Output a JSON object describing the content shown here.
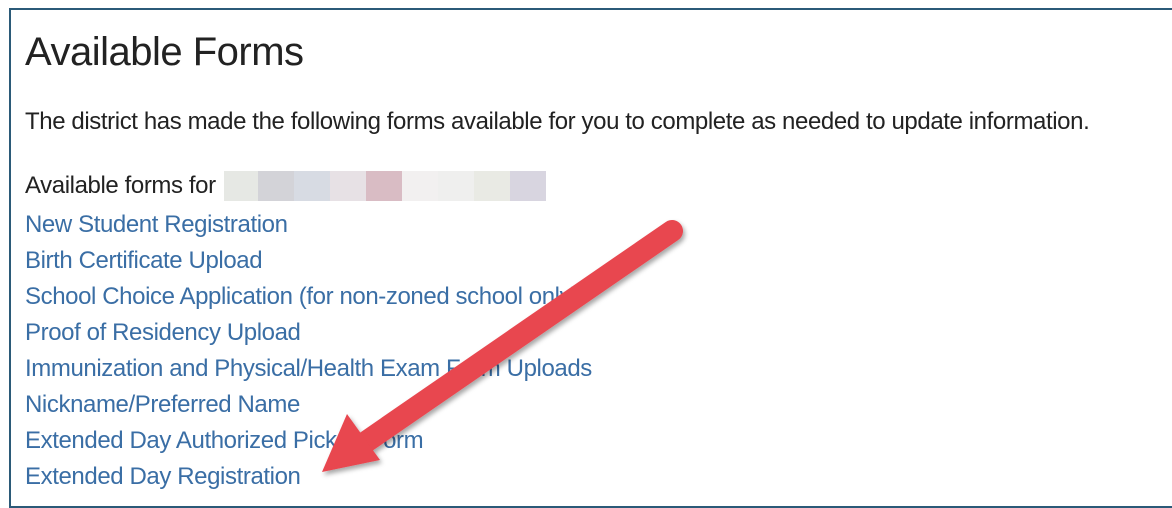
{
  "page": {
    "title": "Available Forms",
    "intro": "The district has made the following forms available for you to complete as needed to update information.",
    "forms_for_label": "Available forms for"
  },
  "forms": [
    {
      "label": "New Student Registration"
    },
    {
      "label": "Birth Certificate Upload"
    },
    {
      "label": "School Choice Application (for non-zoned school only)"
    },
    {
      "label": "Proof of Residency Upload"
    },
    {
      "label": "Immunization and Physical/Health Exam Form Uploads"
    },
    {
      "label": "Nickname/Preferred Name"
    },
    {
      "label": "Extended Day Authorized Pickup Form"
    },
    {
      "label": "Extended Day Registration"
    }
  ],
  "colors": {
    "link": "#3a6ea5",
    "text": "#222222",
    "border": "#2b5a78",
    "annotation_arrow": "#e8464f"
  },
  "redacted_swatches": [
    "#e6e8e4",
    "#d3d3d8",
    "#d7dbe3",
    "#e7e1e5",
    "#d9bcc4",
    "#f2f0f0",
    "#efefee",
    "#e9eae4",
    "#d8d5e0"
  ],
  "annotation": {
    "icon": "red-arrow-icon"
  }
}
